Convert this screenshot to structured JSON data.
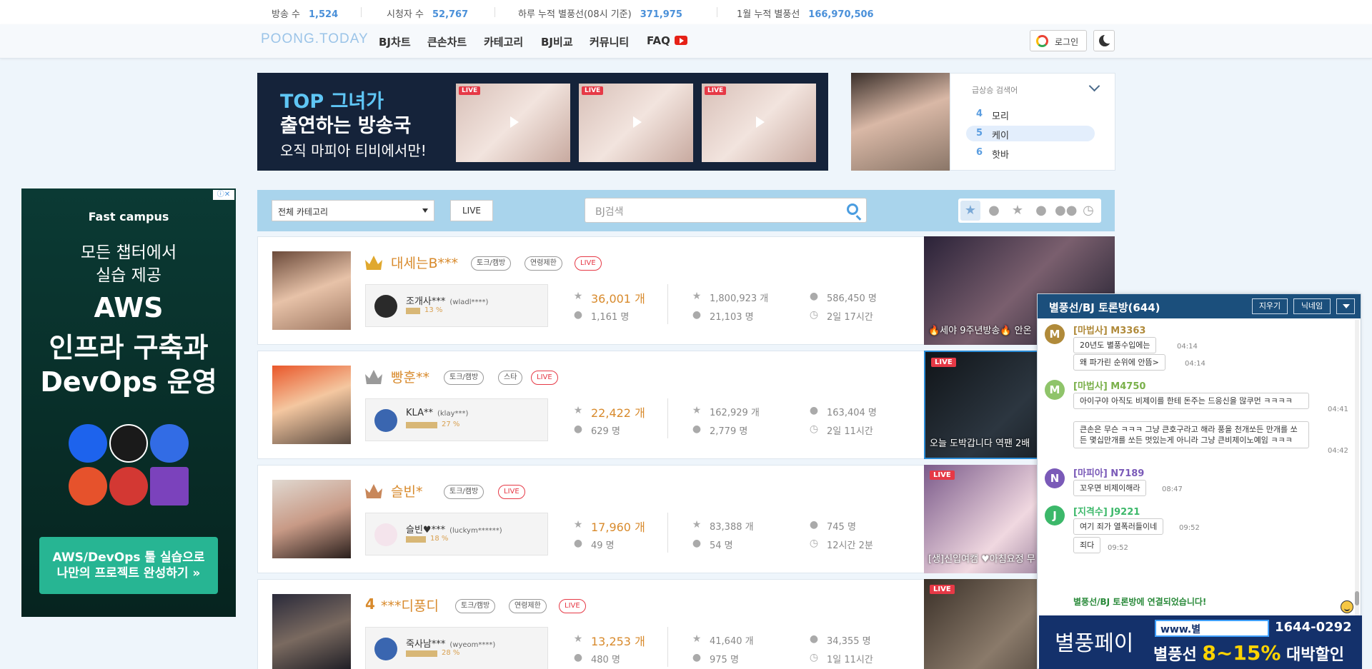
{
  "stats": [
    {
      "label": "방송 수",
      "value": "1,524"
    },
    {
      "label": "시청자 수",
      "value": "52,767"
    },
    {
      "label": "하루 누적 별풍선(08시 기준)",
      "value": "371,975"
    },
    {
      "label": "1월 누적 별풍선",
      "value": "166,970,506"
    }
  ],
  "nav": {
    "logo": "POONG.TODAY",
    "items": [
      "BJ차트",
      "큰손차트",
      "카테고리",
      "BJ비교",
      "커뮤니티",
      "FAQ"
    ],
    "login_label": "로그인"
  },
  "banner": {
    "line1": "TOP 그녀가",
    "line2": "출연하는 방송국",
    "line3": "오직 마피아 티비에서만!",
    "live_tag": "LIVE"
  },
  "trending": {
    "title": "급상승 검색어",
    "items": [
      {
        "rank": "4",
        "name": "모리"
      },
      {
        "rank": "5",
        "name": "케이"
      },
      {
        "rank": "6",
        "name": "핫바"
      }
    ]
  },
  "ad": {
    "close": "ⓘ✕",
    "brand": "Fast campus",
    "line1": "모든 챕터에서",
    "line2": "실습 제공",
    "big1": "AWS",
    "big2": "인프라 구축과",
    "big3": "DevOps 운영",
    "cta1": "AWS/DevOps 툴 실습으로",
    "cta2": "나만의 프로젝트 완성하기 »"
  },
  "filter": {
    "category": "전체 카테고리",
    "live_label": "LIVE",
    "search_placeholder": "BJ검색"
  },
  "bjs": [
    {
      "rank_label": "",
      "name": "대세는B***",
      "tags": [
        "토크/캠방",
        "연령제한",
        "LIVE"
      ],
      "fan_name": "조개사***",
      "fan_id": "(wladl****)",
      "fan_pct": "13 %",
      "balloons": "36,001 개",
      "viewers": "1,161 명",
      "total_balloons": "1,800,923 개",
      "total_viewers": "21,103 명",
      "fans": "586,450 명",
      "duration": "2일 17시간",
      "thumb_title": "🔥세야 9주년방송🔥 안온"
    },
    {
      "rank_label": "",
      "name": "빵훈**",
      "tags": [
        "토크/캠방",
        "스타",
        "LIVE"
      ],
      "fan_name": "KLA**",
      "fan_id": "(klay***)",
      "fan_pct": "27 %",
      "balloons": "22,422 개",
      "viewers": "629 명",
      "total_balloons": "162,929 개",
      "total_viewers": "2,779 명",
      "fans": "163,404 명",
      "duration": "2일 11시간",
      "thumb_title": "오늘 도박갑니다 역팬 2배"
    },
    {
      "rank_label": "",
      "name": "슬빈*",
      "tags": [
        "토크/캠방",
        "LIVE"
      ],
      "fan_name": "슬빈♥***",
      "fan_id": "(luckym******)",
      "fan_pct": "18 %",
      "balloons": "17,960 개",
      "viewers": "49 명",
      "total_balloons": "83,388 개",
      "total_viewers": "54 명",
      "fans": "745 명",
      "duration": "12시간 2분",
      "thumb_title": "[생]신입여캠 ♥아침요정 무"
    },
    {
      "rank_label": "4",
      "name": "***디풍디",
      "tags": [
        "토크/캠방",
        "연령제한",
        "LIVE"
      ],
      "fan_name": "죽사남***",
      "fan_id": "(wyeom****)",
      "fan_pct": "28 %",
      "balloons": "13,253 개",
      "viewers": "480 명",
      "total_balloons": "41,640 개",
      "total_viewers": "975 명",
      "fans": "34,355 명",
      "duration": "1일 11시간",
      "thumb_title": ""
    }
  ],
  "chat": {
    "title": "별풍선/BJ 토론방(644)",
    "clear_label": "지우기",
    "nick_label": "닉네임",
    "messages": [
      {
        "avatar": "M",
        "user": "[마법사] M3363",
        "lines": [
          "20년도 별풍수입에는",
          "왜 파가린 순위에 안뜸>"
        ],
        "times": [
          "04:14",
          "04:14"
        ]
      },
      {
        "avatar": "M",
        "user": "[마법사] M4750",
        "lines": [
          "아이구야 아직도 비제이를 한테 돈주는 드응신을 많쿠먼 ㅋㅋㅋㅋ",
          "큰손은 무슨 ㅋㅋㅋ 그냥 큰호구라고 해라 풍을 천개쏘든 만개를 쏘든 몇십만개를 쏘든 멋있는게 아니라 그냥 큰비제이노예임 ㅋㅋㅋ"
        ],
        "times": [
          "04:41",
          "04:42"
        ]
      },
      {
        "avatar": "N",
        "user": "[마피아] N7189",
        "lines": [
          "꼬우면 비제이해라"
        ],
        "times": [
          "08:47"
        ]
      },
      {
        "avatar": "J",
        "user": "[지격수] J9221",
        "lines": [
          "여기 죄가 열폭러들이네",
          "죄다"
        ],
        "times": [
          "09:52",
          "09:52"
        ]
      }
    ],
    "system": "별풍선/BJ 토론방에 연결되었습니다!"
  },
  "chat_ad": {
    "brand": "별풍페이",
    "url": "www.별",
    "phone": "1644-0292",
    "promo_prefix": "별풍선",
    "promo_pct": "8~15%",
    "promo_suffix": "대박할인"
  },
  "colors": {
    "accent": "#4a90d9",
    "rank": "#d88a2c",
    "live": "#e63946",
    "chat_header": "#1b4f7c"
  }
}
